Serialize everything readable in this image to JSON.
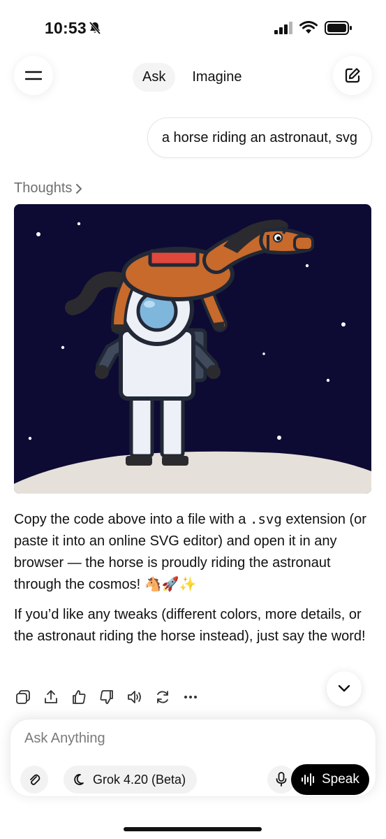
{
  "status_bar": {
    "time": "10:53",
    "icons": [
      "bell-muted-icon",
      "signal-icon",
      "wifi-icon",
      "battery-icon"
    ]
  },
  "top_bar": {
    "tabs": [
      {
        "label": "Ask",
        "active": true
      },
      {
        "label": "Imagine",
        "active": false
      }
    ],
    "left_icon": "menu-icon",
    "right_icon": "edit-icon"
  },
  "user_message": "a horse riding an astronaut, svg",
  "thoughts_label": "Thoughts",
  "reply": {
    "p1_before": "Copy the code above into a file with a ",
    "p1_code": ".svg",
    "p1_after": " extension (or paste it into an online SVG editor) and open it in any browser — the horse is proudly riding the astronaut through the cosmos! 🐴🚀✨",
    "p2": "If you’d like any tweaks (different colors, more details, or the astronaut riding the horse instead), just say the word!"
  },
  "actions": [
    "copy-icon",
    "share-icon",
    "thumbs-up-icon",
    "thumbs-down-icon",
    "speaker-icon",
    "regenerate-icon",
    "more-icon"
  ],
  "composer": {
    "placeholder": "Ask Anything",
    "model_label": "Grok 4.20 (Beta)",
    "speak_label": "Speak"
  },
  "colors": {
    "space_bg": "#0d0b33",
    "ground": "#e6e0da",
    "horse": "#c76a2c",
    "mane": "#2b2b2f",
    "suit": "#eef0f7",
    "visor": "#7fb6dc",
    "saddle": "#e0483c",
    "speak_bg": "#000000"
  }
}
